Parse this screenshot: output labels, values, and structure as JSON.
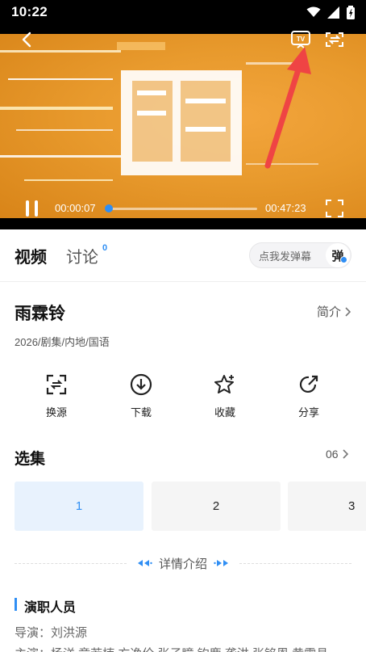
{
  "status_bar": {
    "time": "10:22"
  },
  "player": {
    "current_time": "00:00:07",
    "duration": "00:47:23",
    "progress_fraction": 0.005
  },
  "tabs": {
    "video_label": "视频",
    "discuss_label": "讨论",
    "discuss_count": "0"
  },
  "danmu": {
    "placeholder": "点我发弹幕",
    "button_label": "弹"
  },
  "show": {
    "title": "雨霖铃",
    "intro_label": "简介",
    "meta": "2026/剧集/内地/国语"
  },
  "actions": [
    {
      "label": "换源",
      "icon": "switch-source-icon"
    },
    {
      "label": "下载",
      "icon": "download-icon"
    },
    {
      "label": "收藏",
      "icon": "star-icon"
    },
    {
      "label": "分享",
      "icon": "share-icon"
    }
  ],
  "episodes": {
    "title": "选集",
    "count_label": "06",
    "items": [
      "1",
      "2",
      "3"
    ],
    "active_index": 0
  },
  "details": {
    "label": "详情介绍"
  },
  "cast": {
    "title": "演职人员",
    "director": "导演：刘洪源",
    "actors": "主演：杨洋 章若楠 方逸伦 张子瞳 钧鹿 龚洪 张铭恩 黄雯具"
  },
  "colors": {
    "accent": "#2f8ef4",
    "video_bg": "#e89a2d",
    "annotation_arrow": "#ef4444"
  }
}
